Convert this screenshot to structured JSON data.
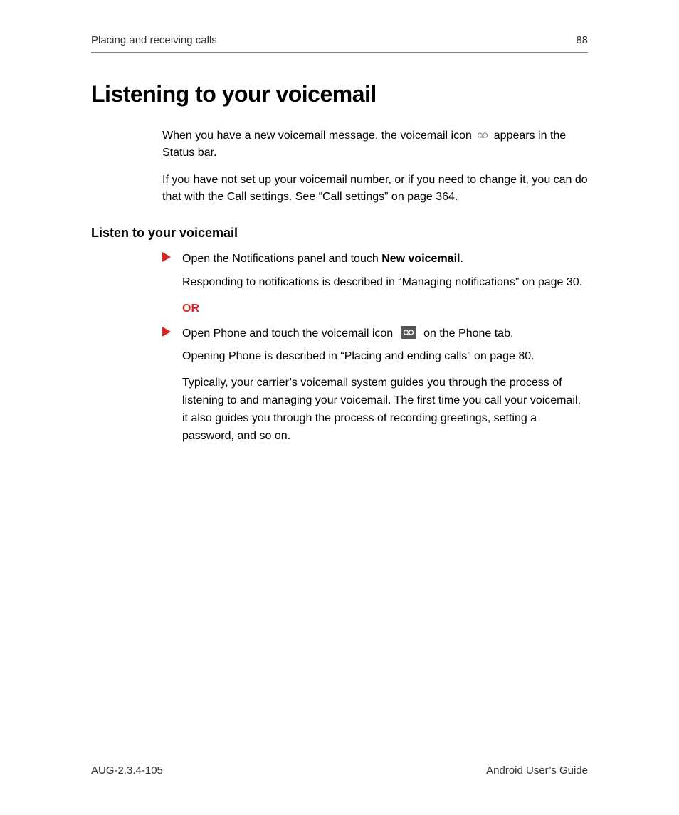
{
  "header": {
    "section": "Placing and receiving calls",
    "page_number": "88"
  },
  "title": "Listening to your voicemail",
  "intro_p1_a": "When you have a new voicemail message, the voicemail icon ",
  "intro_p1_b": " appears in the Status bar.",
  "intro_p2": "If you have not set up your voicemail number, or if you need to change it, you can do that with the Call settings. See “Call settings” on page 364.",
  "subheading": "Listen to your voicemail",
  "step1_a": "Open the Notifications panel and touch ",
  "step1_bold": "New voicemail",
  "step1_b": ".",
  "step1_note": "Responding to notifications is described in “Managing notifications” on page 30.",
  "or_label": "OR",
  "step2_a": "Open Phone and touch the voicemail icon ",
  "step2_b": " on the Phone tab.",
  "step2_note": "Opening Phone is described in “Placing and ending calls” on page 80.",
  "carrier_note": "Typically, your carrier’s voicemail system guides you through the process of listening to and managing your voicemail. The first time you call your voicemail, it also guides you through the process of recording greetings, setting a password, and so on.",
  "footer": {
    "doc_id": "AUG-2.3.4-105",
    "doc_title": "Android User’s Guide"
  }
}
